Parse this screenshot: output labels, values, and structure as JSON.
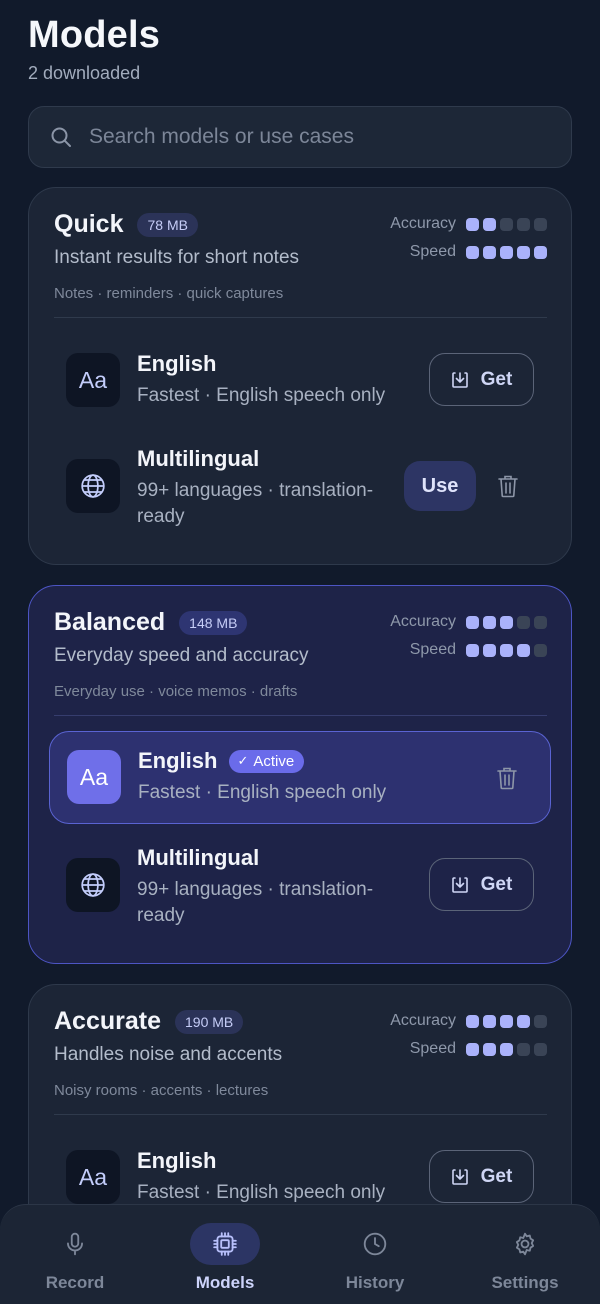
{
  "header": {
    "title": "Models",
    "subtitle": "2 downloaded"
  },
  "search": {
    "placeholder": "Search models or use cases"
  },
  "labels": {
    "accuracy": "Accuracy",
    "speed": "Speed",
    "get": "Get",
    "use": "Use",
    "active": "Active",
    "icon_text": "Aa"
  },
  "colors": {
    "accent": "#6f6fe9",
    "dot_on": "#aab2fb",
    "background": "#111a2b"
  },
  "cards": [
    {
      "name": "Quick",
      "size": "78 MB",
      "description": "Instant results for short notes",
      "uses": "Notes · reminders · quick captures",
      "accuracy": 2,
      "speed": 5,
      "variants": [
        {
          "name": "English",
          "subtitle": "Fastest · English speech only",
          "icon": "text-aa-icon",
          "action": "get"
        },
        {
          "name": "Multilingual",
          "subtitle": "99+ languages · translation-ready",
          "icon": "globe-icon",
          "action": "use"
        }
      ]
    },
    {
      "name": "Balanced",
      "size": "148 MB",
      "description": "Everyday speed and accuracy",
      "uses": "Everyday use · voice memos · drafts",
      "accuracy": 3,
      "speed": 4,
      "variants": [
        {
          "name": "English",
          "subtitle": "Fastest · English speech only",
          "icon": "text-aa-icon",
          "action": "active"
        },
        {
          "name": "Multilingual",
          "subtitle": "99+ languages · translation-ready",
          "icon": "globe-icon",
          "action": "get"
        }
      ]
    },
    {
      "name": "Accurate",
      "size": "190 MB",
      "description": "Handles noise and accents",
      "uses": "Noisy rooms · accents · lectures",
      "accuracy": 4,
      "speed": 3,
      "variants": [
        {
          "name": "English",
          "subtitle": "Fastest · English speech only",
          "icon": "text-aa-icon",
          "action": "get"
        }
      ]
    }
  ],
  "nav": [
    {
      "label": "Record",
      "icon": "microphone-icon",
      "selected": false
    },
    {
      "label": "Models",
      "icon": "chip-icon",
      "selected": true
    },
    {
      "label": "History",
      "icon": "clock-icon",
      "selected": false
    },
    {
      "label": "Settings",
      "icon": "gear-icon",
      "selected": false
    }
  ]
}
